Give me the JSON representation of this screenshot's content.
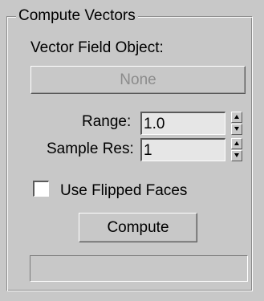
{
  "panel": {
    "group_title": "Compute Vectors",
    "vector_field_object_label": "Vector Field Object:",
    "vector_field_object_button": "None",
    "range_label": "Range:",
    "range_value": "1.0",
    "sample_res_label": "Sample Res:",
    "sample_res_value": "1",
    "use_flipped_faces_label": "Use Flipped Faces",
    "use_flipped_faces_checked": false,
    "compute_button": "Compute",
    "progress_fraction": 0
  }
}
